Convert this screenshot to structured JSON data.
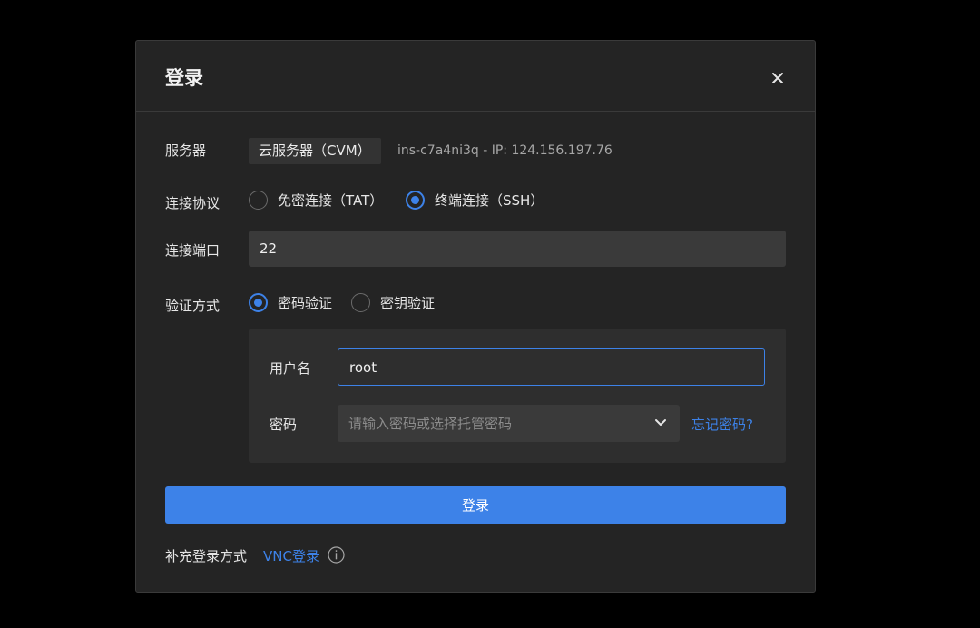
{
  "dialog": {
    "title": "登录",
    "close_icon": "close-icon"
  },
  "server": {
    "label": "服务器",
    "type_tag": "云服务器（CVM）",
    "info": "ins-c7a4ni3q - IP: 124.156.197.76"
  },
  "protocol": {
    "label": "连接协议",
    "options": [
      {
        "label": "免密连接（TAT）",
        "checked": false
      },
      {
        "label": "终端连接（SSH）",
        "checked": true
      }
    ]
  },
  "port": {
    "label": "连接端口",
    "value": "22"
  },
  "auth": {
    "label": "验证方式",
    "options": [
      {
        "label": "密码验证",
        "checked": true
      },
      {
        "label": "密钥验证",
        "checked": false
      }
    ],
    "username_label": "用户名",
    "username_value": "root",
    "password_label": "密码",
    "password_placeholder": "请输入密码或选择托管密码",
    "forgot_link": "忘记密码?"
  },
  "login_button": "登录",
  "footer": {
    "label": "补充登录方式",
    "vnc_link": "VNC登录",
    "info_icon": "info-icon"
  },
  "colors": {
    "accent": "#3d82e8",
    "dialog_bg": "#242424",
    "backdrop": "#000000"
  }
}
